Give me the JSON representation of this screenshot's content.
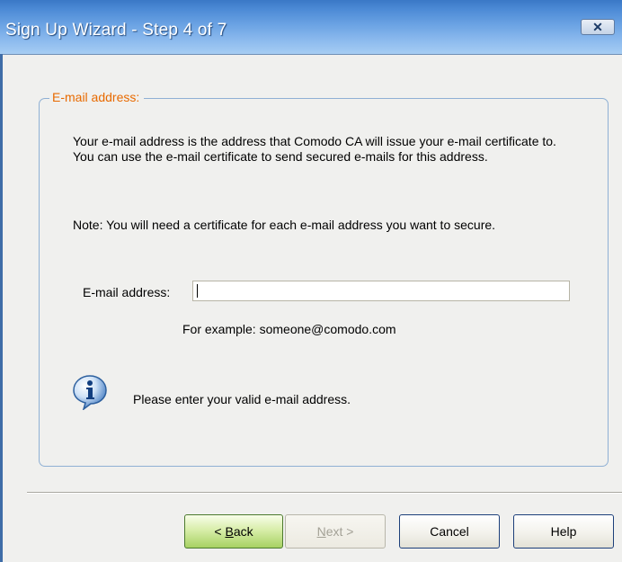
{
  "window": {
    "title": "Sign Up Wizard - Step 4 of 7",
    "close_glyph": "✕"
  },
  "group": {
    "legend": "E-mail address:"
  },
  "description": {
    "paragraph1": "Your e-mail address is the address that Comodo CA will issue your e-mail certificate to.  You can use the e-mail certificate to send secured e-mails for this address.",
    "paragraph2": "Note:  You will need a certificate for each e-mail address you want to secure."
  },
  "email": {
    "label": "E-mail address:",
    "value": "",
    "example": "For example: someone@comodo.com"
  },
  "info": {
    "icon": "info-icon",
    "message": "Please enter your valid e-mail address."
  },
  "buttons": {
    "back_prefix": "< ",
    "back_mnemonic": "B",
    "back_rest": "ack",
    "next_mnemonic": "N",
    "next_rest": "ext >",
    "cancel": "Cancel",
    "help": "Help"
  },
  "colors": {
    "title_bar": "#4d8bd6",
    "legend": "#e86a00",
    "group_border": "#8fb0d4",
    "back_button": "#a7d162"
  }
}
